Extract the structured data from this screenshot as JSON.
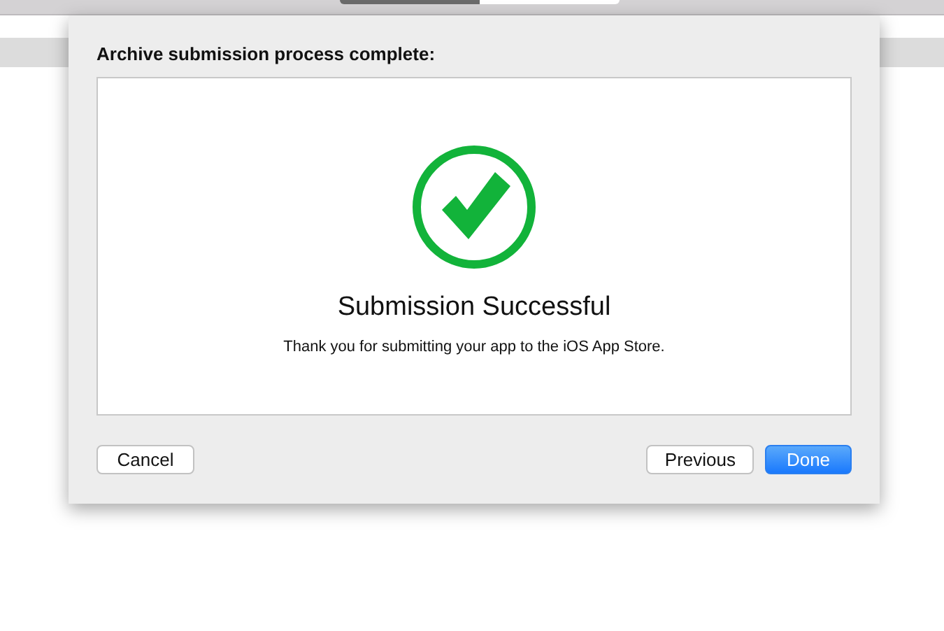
{
  "sheet": {
    "title": "Archive submission process complete:",
    "panel": {
      "heading": "Submission Successful",
      "message": "Thank you for submitting your app to the iOS App Store."
    },
    "left_buttons": [
      {
        "label": "Cancel",
        "kind": "plain"
      }
    ],
    "right_buttons": [
      {
        "label": "Previous",
        "kind": "plain"
      },
      {
        "label": "Done",
        "kind": "default"
      }
    ]
  }
}
